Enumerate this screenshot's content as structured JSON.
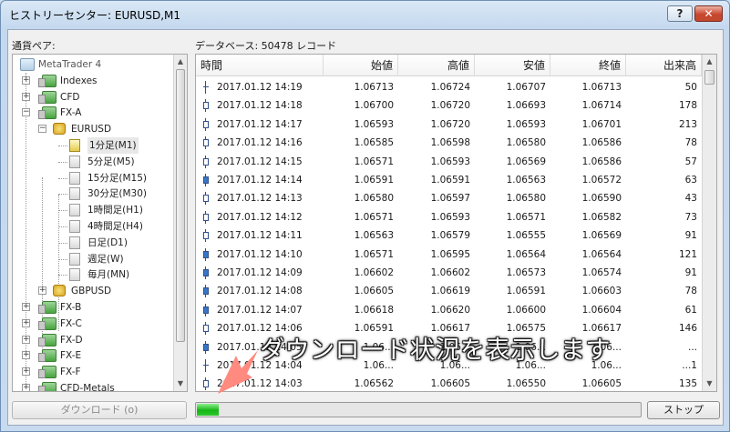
{
  "window": {
    "title": "ヒストリーセンター: EURUSD,M1",
    "help_label": "?",
    "close_label": "✕"
  },
  "labels": {
    "pair": "通貨ペア:",
    "database": "データベース: 50478 レコード"
  },
  "tree": [
    {
      "label": "MetaTrader 4",
      "kind": "root",
      "level": 0,
      "expander": ""
    },
    {
      "label": "Indexes",
      "kind": "group",
      "level": 1,
      "expander": "+"
    },
    {
      "label": "CFD",
      "kind": "group",
      "level": 1,
      "expander": "+"
    },
    {
      "label": "FX-A",
      "kind": "group",
      "level": 1,
      "expander": "−"
    },
    {
      "label": "EURUSD",
      "kind": "symbol",
      "level": 2,
      "expander": "−"
    },
    {
      "label": "1分足(M1)",
      "kind": "file-active",
      "level": 3,
      "expander": "",
      "selected": true
    },
    {
      "label": "5分足(M5)",
      "kind": "file",
      "level": 3,
      "expander": ""
    },
    {
      "label": "15分足(M15)",
      "kind": "file",
      "level": 3,
      "expander": ""
    },
    {
      "label": "30分足(M30)",
      "kind": "file",
      "level": 3,
      "expander": ""
    },
    {
      "label": "1時間足(H1)",
      "kind": "file",
      "level": 3,
      "expander": ""
    },
    {
      "label": "4時間足(H4)",
      "kind": "file",
      "level": 3,
      "expander": ""
    },
    {
      "label": "日足(D1)",
      "kind": "file",
      "level": 3,
      "expander": ""
    },
    {
      "label": "週足(W)",
      "kind": "file",
      "level": 3,
      "expander": ""
    },
    {
      "label": "毎月(MN)",
      "kind": "file",
      "level": 3,
      "expander": ""
    },
    {
      "label": "GBPUSD",
      "kind": "symbol",
      "level": 2,
      "expander": "+"
    },
    {
      "label": "FX-B",
      "kind": "group",
      "level": 1,
      "expander": "+"
    },
    {
      "label": "FX-C",
      "kind": "group",
      "level": 1,
      "expander": "+"
    },
    {
      "label": "FX-D",
      "kind": "group",
      "level": 1,
      "expander": "+"
    },
    {
      "label": "FX-E",
      "kind": "group",
      "level": 1,
      "expander": "+"
    },
    {
      "label": "FX-F",
      "kind": "group",
      "level": 1,
      "expander": "+"
    },
    {
      "label": "CFD-Metals",
      "kind": "group",
      "level": 1,
      "expander": "+"
    }
  ],
  "table": {
    "columns": [
      "時間",
      "始値",
      "高値",
      "安値",
      "終値",
      "出来高"
    ],
    "rows": [
      {
        "candle": "flat",
        "time": "2017.01.12 14:19",
        "open": "1.06713",
        "high": "1.06724",
        "low": "1.06707",
        "close": "1.06713",
        "volume": "50"
      },
      {
        "candle": "up",
        "time": "2017.01.12 14:18",
        "open": "1.06700",
        "high": "1.06720",
        "low": "1.06693",
        "close": "1.06714",
        "volume": "178"
      },
      {
        "candle": "up",
        "time": "2017.01.12 14:17",
        "open": "1.06593",
        "high": "1.06720",
        "low": "1.06593",
        "close": "1.06701",
        "volume": "213"
      },
      {
        "candle": "up",
        "time": "2017.01.12 14:16",
        "open": "1.06585",
        "high": "1.06598",
        "low": "1.06580",
        "close": "1.06586",
        "volume": "78"
      },
      {
        "candle": "up",
        "time": "2017.01.12 14:15",
        "open": "1.06571",
        "high": "1.06593",
        "low": "1.06569",
        "close": "1.06586",
        "volume": "57"
      },
      {
        "candle": "down",
        "time": "2017.01.12 14:14",
        "open": "1.06591",
        "high": "1.06591",
        "low": "1.06563",
        "close": "1.06572",
        "volume": "63"
      },
      {
        "candle": "up",
        "time": "2017.01.12 14:13",
        "open": "1.06580",
        "high": "1.06597",
        "low": "1.06580",
        "close": "1.06590",
        "volume": "43"
      },
      {
        "candle": "up",
        "time": "2017.01.12 14:12",
        "open": "1.06571",
        "high": "1.06593",
        "low": "1.06571",
        "close": "1.06582",
        "volume": "73"
      },
      {
        "candle": "up",
        "time": "2017.01.12 14:11",
        "open": "1.06563",
        "high": "1.06579",
        "low": "1.06555",
        "close": "1.06569",
        "volume": "91"
      },
      {
        "candle": "down",
        "time": "2017.01.12 14:10",
        "open": "1.06571",
        "high": "1.06595",
        "low": "1.06564",
        "close": "1.06564",
        "volume": "121"
      },
      {
        "candle": "down",
        "time": "2017.01.12 14:09",
        "open": "1.06602",
        "high": "1.06602",
        "low": "1.06573",
        "close": "1.06574",
        "volume": "91"
      },
      {
        "candle": "down",
        "time": "2017.01.12 14:08",
        "open": "1.06605",
        "high": "1.06619",
        "low": "1.06591",
        "close": "1.06603",
        "volume": "78"
      },
      {
        "candle": "down",
        "time": "2017.01.12 14:07",
        "open": "1.06618",
        "high": "1.06620",
        "low": "1.06600",
        "close": "1.06604",
        "volume": "61"
      },
      {
        "candle": "up",
        "time": "2017.01.12 14:06",
        "open": "1.06591",
        "high": "1.06617",
        "low": "1.06575",
        "close": "1.06617",
        "volume": "146"
      },
      {
        "candle": "down",
        "time": "2017.01.12 14:05",
        "open": "1.06...",
        "high": "1.06...",
        "low": "1.06...",
        "close": "1.06...",
        "volume": "..."
      },
      {
        "candle": "flat",
        "time": "2017.01.12 14:04",
        "open": "1.06...",
        "high": "1.06...",
        "low": "1.06...",
        "close": "1.06...",
        "volume": "...1"
      },
      {
        "candle": "up",
        "time": "2017.01.12 14:03",
        "open": "1.06562",
        "high": "1.06605",
        "low": "1.06550",
        "close": "1.06605",
        "volume": "135"
      }
    ]
  },
  "buttons": {
    "download": "ダウンロード (o)",
    "stop": "ストップ"
  },
  "progress": {
    "fraction": 0.05
  },
  "annotation": {
    "text": "ダウンロード状況を表示します",
    "arrow_color": "#ff8a80"
  }
}
